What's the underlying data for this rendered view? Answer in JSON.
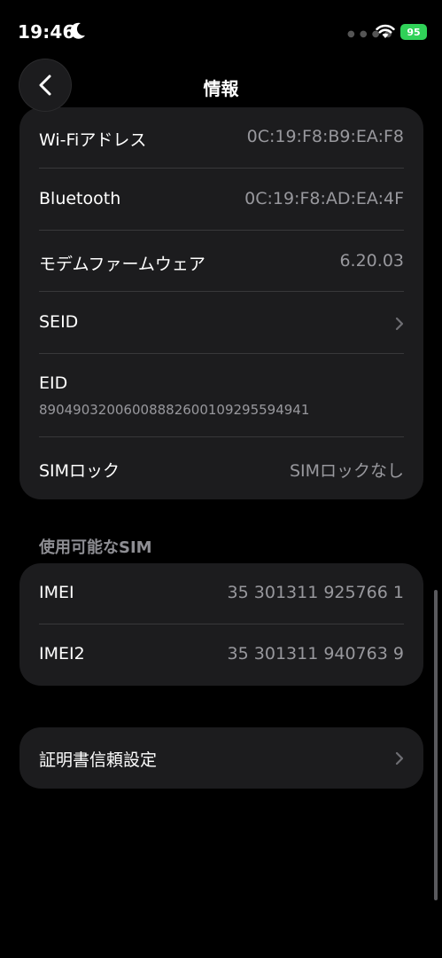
{
  "status_bar": {
    "time": "19:46",
    "battery": "95"
  },
  "nav": {
    "title": "情報"
  },
  "about_rows": [
    {
      "label": "Wi-Fiアドレス",
      "value": "0C:19:F8:B9:EA:F8"
    },
    {
      "label": "Bluetooth",
      "value": "0C:19:F8:AD:EA:4F"
    },
    {
      "label": "モデムファームウェア",
      "value": "6.20.03"
    },
    {
      "label": "SEID"
    },
    {
      "label": "EID",
      "value": "89049032006008882600109295594941"
    },
    {
      "label": "SIMロック",
      "value": "SIMロックなし"
    }
  ],
  "sim_section": {
    "header": "使用可能なSIM",
    "rows": [
      {
        "label": "IMEI",
        "value": "35 301311 925766 1"
      },
      {
        "label": "IMEI2",
        "value": "35 301311 940763 9"
      }
    ]
  },
  "cert_row": {
    "label": "証明書信頼設定"
  },
  "colors": {
    "background": "#000000",
    "card": "#1c1c1e",
    "secondary_text": "#98989d",
    "battery": "#30d158"
  }
}
